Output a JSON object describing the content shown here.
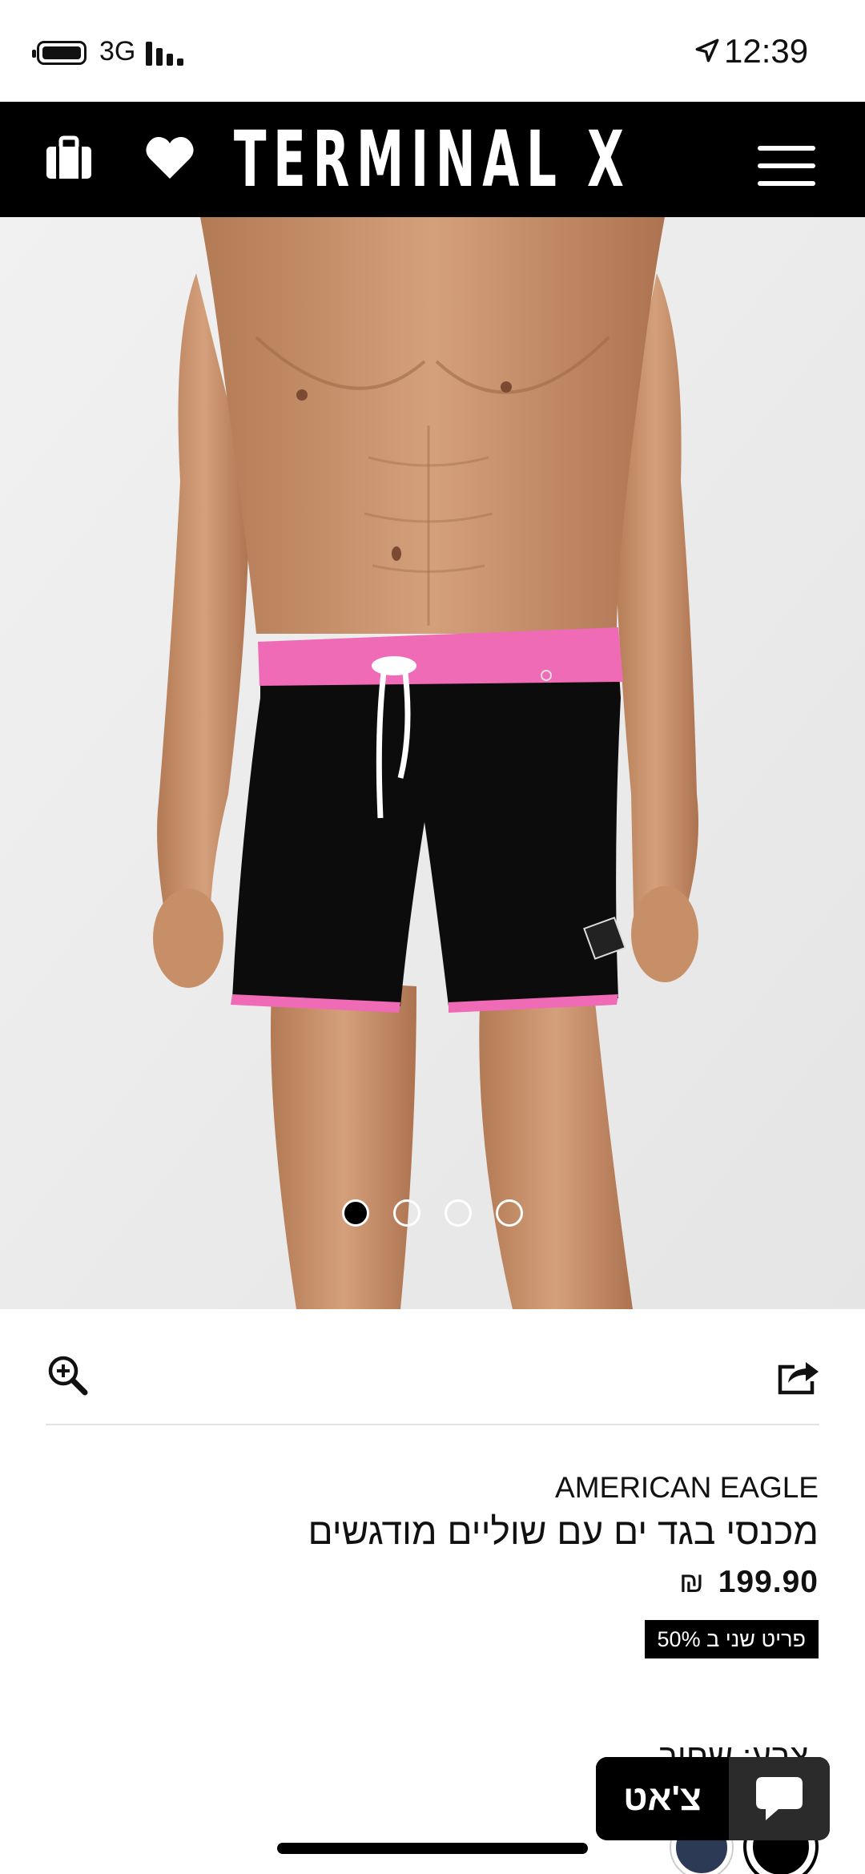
{
  "status_bar": {
    "network": "3G",
    "time": "12:39"
  },
  "header": {
    "logo_text": "TERMINAL X",
    "icons": [
      "bag-icon",
      "heart-icon",
      "menu-icon"
    ]
  },
  "image_carousel": {
    "total_slides": 4,
    "active_slide": 1
  },
  "product": {
    "brand": "AMERICAN EAGLE",
    "title": "מכנסי בגד ים עם שוליים מודגשים",
    "price": "199.90",
    "currency": "₪",
    "promo": "פריט שני ב 50%",
    "color_label": "צבע: שחור"
  },
  "colors": {
    "header_bg": "#000000",
    "image_bg": "#eeeeee",
    "shorts_trim": "#f06bb5",
    "swatch_navy": "#2c3a55",
    "swatch_black": "#000000"
  },
  "chat": {
    "label": "צ'אט"
  }
}
